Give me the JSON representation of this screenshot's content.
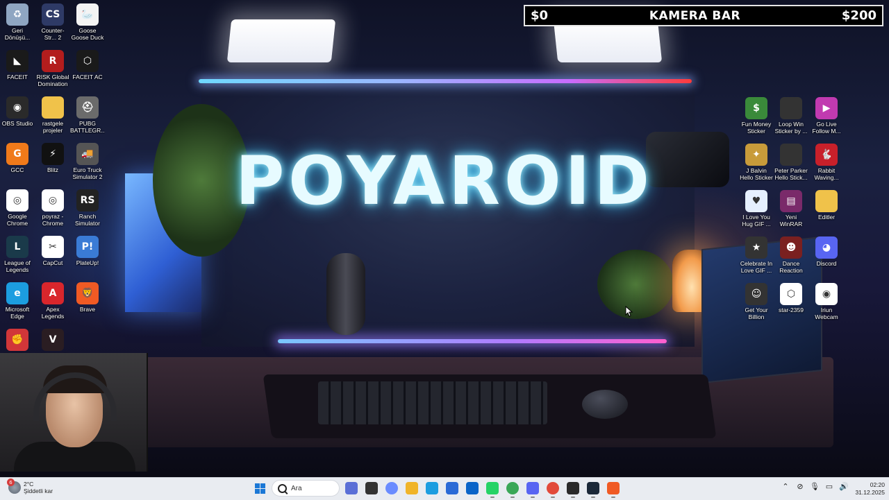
{
  "wallpaper": {
    "title": "POYAROID"
  },
  "overlay": {
    "left": "$0",
    "center": "KAMERA BAR",
    "right": "$200"
  },
  "desktop_left": [
    {
      "label": "Geri Dönüşü...",
      "icon": "recycle-bin-icon",
      "color": "#8fa6c2",
      "glyph": "♻"
    },
    {
      "label": "Counter-Str... 2",
      "icon": "counter-strike-icon",
      "color": "#2e3a66",
      "glyph": "CS"
    },
    {
      "label": "Goose Goose Duck",
      "icon": "goose-icon",
      "color": "#f4f4f4",
      "glyph": "🦢"
    },
    {
      "label": "FACEIT",
      "icon": "faceit-icon",
      "color": "#1a1a1a",
      "glyph": "◣"
    },
    {
      "label": "RISK Global Domination",
      "icon": "risk-icon",
      "color": "#b31d1d",
      "glyph": "R"
    },
    {
      "label": "FACEIT AC",
      "icon": "faceit-ac-icon",
      "color": "#1a1a1a",
      "glyph": "⬡"
    },
    {
      "label": "OBS Studio",
      "icon": "obs-icon",
      "color": "#2a2a2a",
      "glyph": "◉"
    },
    {
      "label": "rastgele projeler",
      "icon": "folder-icon",
      "color": "#f0c24a",
      "glyph": ""
    },
    {
      "label": "PUBG BATTLEGR...",
      "icon": "pubg-icon",
      "color": "#6b6b6b",
      "glyph": "⛑"
    },
    {
      "label": "GCC",
      "icon": "gcc-icon",
      "color": "#f07a1a",
      "glyph": "G"
    },
    {
      "label": "Blitz",
      "icon": "blitz-icon",
      "color": "#111",
      "glyph": "⚡"
    },
    {
      "label": "Euro Truck Simulator 2",
      "icon": "truck-icon",
      "color": "#555",
      "glyph": "🚚"
    },
    {
      "label": "Google Chrome",
      "icon": "chrome-icon",
      "color": "#ffffff",
      "glyph": "◎"
    },
    {
      "label": "poyraz - Chrome",
      "icon": "chrome-profile-icon",
      "color": "#ffffff",
      "glyph": "◎"
    },
    {
      "label": "Ranch Simulator",
      "icon": "ranch-icon",
      "color": "#222",
      "glyph": "RS"
    },
    {
      "label": "League of Legends",
      "icon": "lol-icon",
      "color": "#1a3a4a",
      "glyph": "L"
    },
    {
      "label": "CapCut",
      "icon": "capcut-icon",
      "color": "#ffffff",
      "glyph": "✂"
    },
    {
      "label": "PlateUp!",
      "icon": "plateup-icon",
      "color": "#3a7bd5",
      "glyph": "P!"
    },
    {
      "label": "Microsoft Edge",
      "icon": "edge-icon",
      "color": "#1c9de0",
      "glyph": "e"
    },
    {
      "label": "Apex Legends",
      "icon": "apex-icon",
      "color": "#d9262c",
      "glyph": "A"
    },
    {
      "label": "Brave",
      "icon": "brave-icon",
      "color": "#f05a24",
      "glyph": "🦁"
    },
    {
      "label": "Riot Client",
      "icon": "riot-icon",
      "color": "#d13639",
      "glyph": "✊"
    },
    {
      "label": "VALORANT",
      "icon": "valorant-icon",
      "color": "#2a1d22",
      "glyph": "V"
    }
  ],
  "desktop_right": [
    {
      "label": "Fun Money Sticker",
      "icon": "money-sticker-icon",
      "color": "#3a8a3a",
      "glyph": "$"
    },
    {
      "label": "Loop Win Sticker by ...",
      "icon": "loop-sticker-icon",
      "color": "#333",
      "glyph": ""
    },
    {
      "label": "Go Live Follow M...",
      "icon": "golive-sticker-icon",
      "color": "#c13ab0",
      "glyph": "▶"
    },
    {
      "label": "J Balvin Hello Sticker by P...",
      "icon": "jbalvin-sticker-icon",
      "color": "#c89b3a",
      "glyph": "✦"
    },
    {
      "label": "Peter Parker Hello Stick...",
      "icon": "peter-sticker-icon",
      "color": "#333",
      "glyph": ""
    },
    {
      "label": "Rabbit Waving...",
      "icon": "rabbit-sticker-icon",
      "color": "#c8202a",
      "glyph": "🐇"
    },
    {
      "label": "I Love You Hug GIF ...",
      "icon": "hug-gif-icon",
      "color": "#e6f0ff",
      "glyph": "♥"
    },
    {
      "label": "Yeni WinRAR arşivi",
      "icon": "winrar-icon",
      "color": "#7a2a6a",
      "glyph": "▤"
    },
    {
      "label": "Editler",
      "icon": "folder-icon",
      "color": "#f0c24a",
      "glyph": ""
    },
    {
      "label": "Celebrate In Love GIF ...",
      "icon": "celebrate-gif-icon",
      "color": "#333",
      "glyph": "★"
    },
    {
      "label": "Dance Reaction GIF",
      "icon": "dance-gif-icon",
      "color": "#7a2020",
      "glyph": "☻"
    },
    {
      "label": "Discord",
      "icon": "discord-icon",
      "color": "#5865f2",
      "glyph": "◕"
    },
    {
      "label": "Get Your Billion Back...",
      "icon": "billion-gif-icon",
      "color": "#333",
      "glyph": "☺"
    },
    {
      "label": "star-2359",
      "icon": "file-icon",
      "color": "#ffffff",
      "glyph": "⬡"
    },
    {
      "label": "Iriun Webcam",
      "icon": "iriun-icon",
      "color": "#ffffff",
      "glyph": "◉"
    }
  ],
  "taskbar": {
    "weather": {
      "badge": "6",
      "temp": "2°C",
      "desc": "Şiddetli kar"
    },
    "search_placeholder": "Ara",
    "apps": [
      {
        "name": "widgets-button",
        "color": "#5a6fd6"
      },
      {
        "name": "task-view-button",
        "color": "#333"
      },
      {
        "name": "copilot-button",
        "color": "#6a8cff"
      },
      {
        "name": "file-explorer-button",
        "color": "#f0b429"
      },
      {
        "name": "edge-button",
        "color": "#1c9de0"
      },
      {
        "name": "store-button",
        "color": "#2a6ad6"
      },
      {
        "name": "outlook-button",
        "color": "#0a64c8"
      },
      {
        "name": "whatsapp-button",
        "color": "#25d366"
      },
      {
        "name": "chrome-button",
        "color": "#3aa757"
      },
      {
        "name": "discord-button",
        "color": "#5865f2"
      },
      {
        "name": "chrome-profile-button",
        "color": "#e24a3a"
      },
      {
        "name": "obs-button",
        "color": "#2a2a2a"
      },
      {
        "name": "steam-button",
        "color": "#1b2838"
      },
      {
        "name": "brave-button",
        "color": "#f05a24"
      }
    ],
    "clock": {
      "time": "02:20",
      "date": "31.12.2025"
    }
  }
}
